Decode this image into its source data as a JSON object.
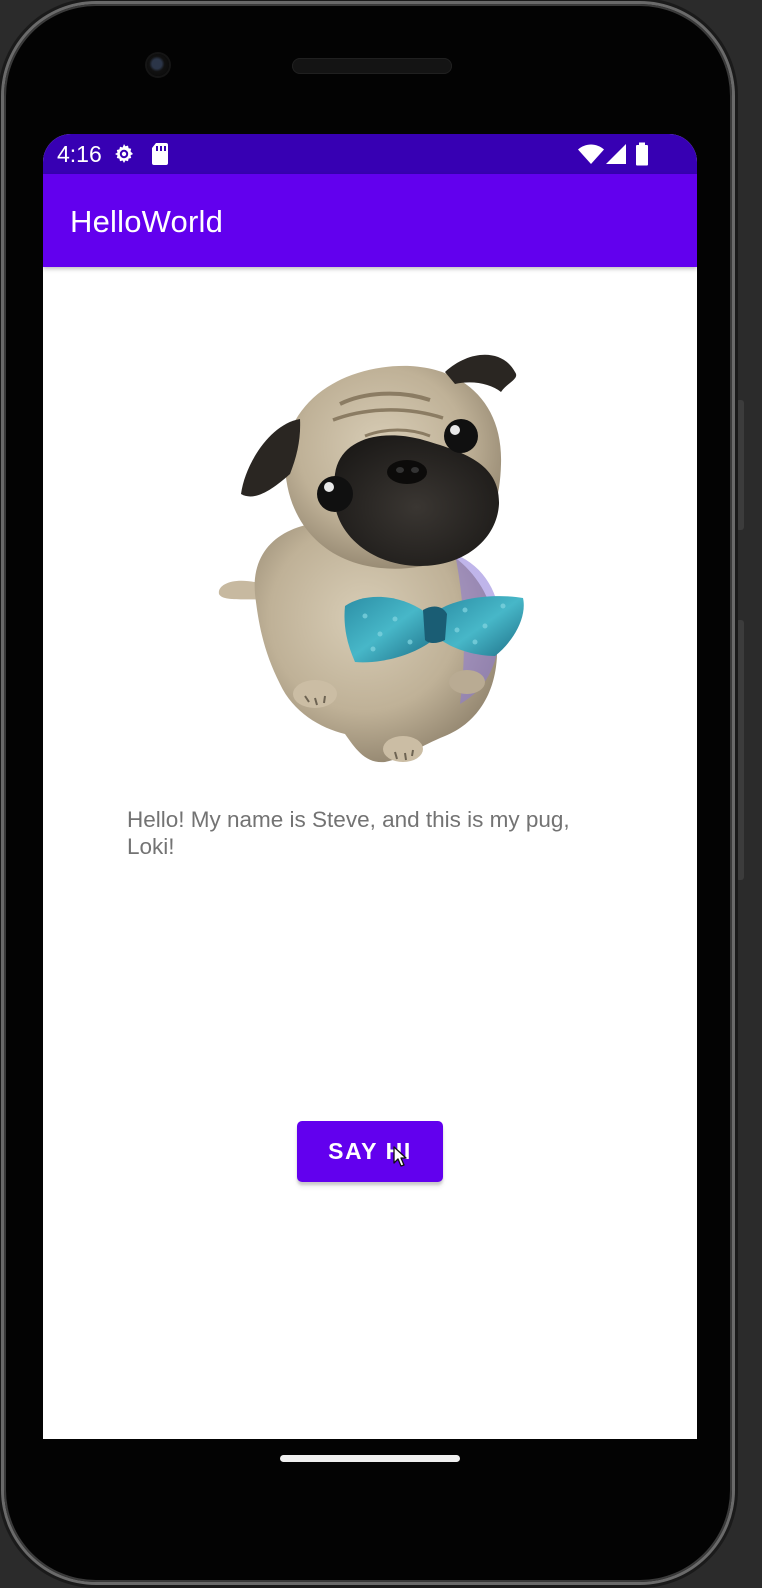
{
  "status_bar": {
    "time": "4:16",
    "icons": [
      "settings-gear-icon",
      "sd-card-icon",
      "wifi-icon",
      "cell-signal-icon",
      "battery-icon"
    ],
    "background_color": "#3700b3"
  },
  "app_bar": {
    "title": "HelloWorld",
    "background_color": "#6200ee"
  },
  "content": {
    "image": "pug-with-blue-bow-tie",
    "greeting": "Hello! My name is Steve, and this is my pug, Loki!",
    "button_label": "SAY HI",
    "button_color": "#6200ee"
  },
  "navigation": {
    "home_indicator": "gesture-pill"
  }
}
